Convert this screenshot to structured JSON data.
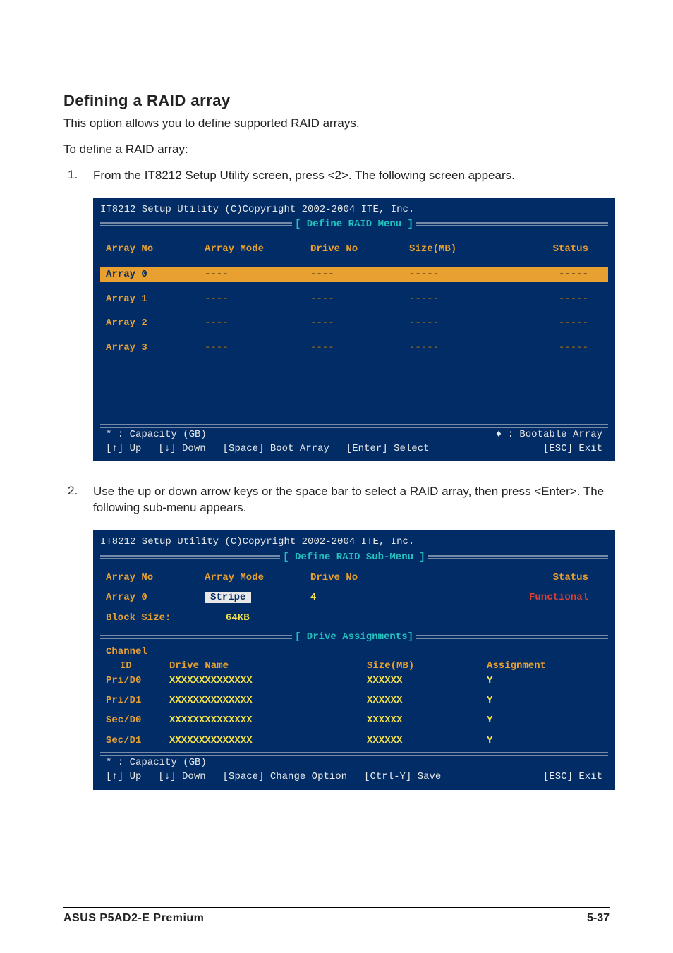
{
  "heading": "Defining a RAID array",
  "intro1": "This option allows you to define supported RAID arrays.",
  "intro2": "To define a RAID array:",
  "step1_num": "1.",
  "step1_text": "From the IT8212 Setup Utility screen, press <2>. The following screen appears.",
  "step2_num": "2.",
  "step2_text": "Use the up or down arrow keys or the space bar to select a RAID array,  then press <Enter>. The following sub-menu appears.",
  "s1": {
    "title": "IT8212 Setup Utility (C)Copyright 2002-2004 ITE, Inc.",
    "banner": "[ Define RAID Menu ]",
    "hdr": {
      "c1": "Array No",
      "c2": "Array Mode",
      "c3": "Drive No",
      "c4": "Size(MB)",
      "c5": "Status"
    },
    "rows": [
      {
        "c1": "Array 0",
        "c2": "----",
        "c3": "----",
        "c4": "-----",
        "c5": "-----"
      },
      {
        "c1": "Array 1",
        "c2": "----",
        "c3": "----",
        "c4": "-----",
        "c5": "-----"
      },
      {
        "c1": "Array 2",
        "c2": "----",
        "c3": "----",
        "c4": "-----",
        "c5": "-----"
      },
      {
        "c1": "Array 3",
        "c2": "----",
        "c3": "----",
        "c4": "-----",
        "c5": "-----"
      }
    ],
    "cap": "* : Capacity (GB)",
    "boot": "♦ : Bootable Array",
    "k_up": "[↑] Up",
    "k_down": "[↓] Down",
    "k_space": "[Space] Boot Array",
    "k_enter": "[Enter] Select",
    "k_esc": "[ESC] Exit"
  },
  "s2": {
    "title": "IT8212 Setup Utility (C)Copyright 2002-2004 ITE, Inc.",
    "banner": "[ Define RAID Sub-Menu ]",
    "hdr": {
      "c1": "Array No",
      "c2": "Array Mode",
      "c3": "Drive No",
      "c5": "Status"
    },
    "row": {
      "c1": "Array 0",
      "c2": "Stripe",
      "c3": "4",
      "c5": "Functional"
    },
    "block_label": "Block Size:",
    "block_val": "64KB",
    "drv_banner": "[ Drive Assignments]",
    "drv_hdr0": "Channel",
    "drv_hdr": {
      "d1": "ID",
      "d2": "Drive Name",
      "d3": "Size(MB)",
      "d4": "Assignment"
    },
    "drives": [
      {
        "d1": "Pri/D0",
        "d2": "XXXXXXXXXXXXXX",
        "d3": "XXXXXX",
        "d4": "Y"
      },
      {
        "d1": "Pri/D1",
        "d2": "XXXXXXXXXXXXXX",
        "d3": "XXXXXX",
        "d4": "Y"
      },
      {
        "d1": "Sec/D0",
        "d2": "XXXXXXXXXXXXXX",
        "d3": "XXXXXX",
        "d4": "Y"
      },
      {
        "d1": "Sec/D1",
        "d2": "XXXXXXXXXXXXXX",
        "d3": "XXXXXX",
        "d4": "Y"
      }
    ],
    "cap": "* : Capacity (GB)",
    "k_up": "[↑] Up",
    "k_down": "[↓] Down",
    "k_space": "[Space] Change Option",
    "k_ctrly": "[Ctrl-Y] Save",
    "k_esc": "[ESC] Exit"
  },
  "footer": {
    "left": "ASUS P5AD2-E Premium",
    "right": "5-37"
  }
}
